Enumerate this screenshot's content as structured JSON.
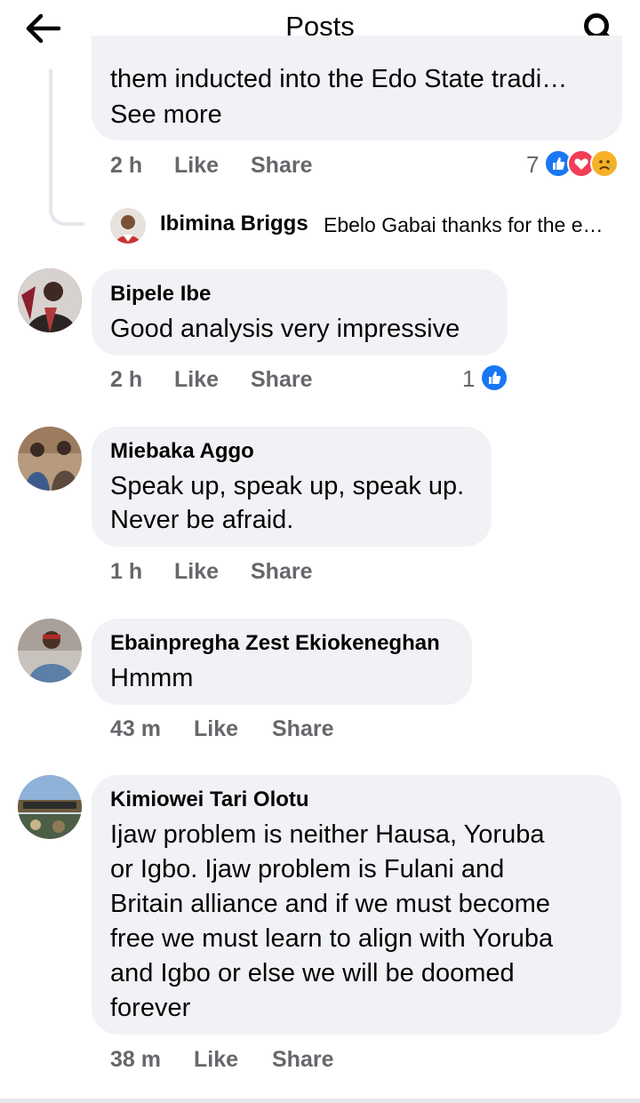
{
  "header": {
    "title": "Posts",
    "back_icon": "arrow-left-icon",
    "search_icon": "search-icon"
  },
  "first_comment": {
    "text_tail": "them inducted into the Edo State tradi…",
    "see_more": "See more",
    "time": "2 h",
    "like_label": "Like",
    "share_label": "Share",
    "reaction_count": "7",
    "reactions": [
      "like-icon",
      "love-icon",
      "sad-icon"
    ],
    "reply": {
      "name": "Ibimina Briggs",
      "text": "Ebelo Gabai thanks for the e…"
    }
  },
  "comments": [
    {
      "name": "Bipele Ibe",
      "lines": [
        "Good analysis very impressive"
      ],
      "time": "2 h",
      "like_label": "Like",
      "share_label": "Share",
      "reaction_count": "1",
      "reactions": [
        "like-icon"
      ]
    },
    {
      "name": "Miebaka Aggo",
      "lines": [
        "Speak up, speak up, speak up.",
        "Never be afraid."
      ],
      "time": "1 h",
      "like_label": "Like",
      "share_label": "Share"
    },
    {
      "name": "Ebainpregha Zest Ekiokeneghan",
      "lines": [
        "Hmmm"
      ],
      "time": "43 m",
      "like_label": "Like",
      "share_label": "Share"
    },
    {
      "name": "Kimiowei Tari Olotu",
      "lines": [
        "Ijaw problem is neither Hausa, Yoruba",
        "or Igbo. Ijaw problem is Fulani and",
        "Britain alliance and if we must become",
        "free we must learn to align with Yoruba",
        "and Igbo or else we will be doomed",
        "forever"
      ],
      "time": "38 m",
      "like_label": "Like",
      "share_label": "Share"
    }
  ],
  "colors": {
    "bubble": "#f0f2f5",
    "meta_text": "#65676b",
    "like_blue": "#1877f2",
    "love_red": "#f33e58",
    "sad_yellow": "#f7b125"
  }
}
